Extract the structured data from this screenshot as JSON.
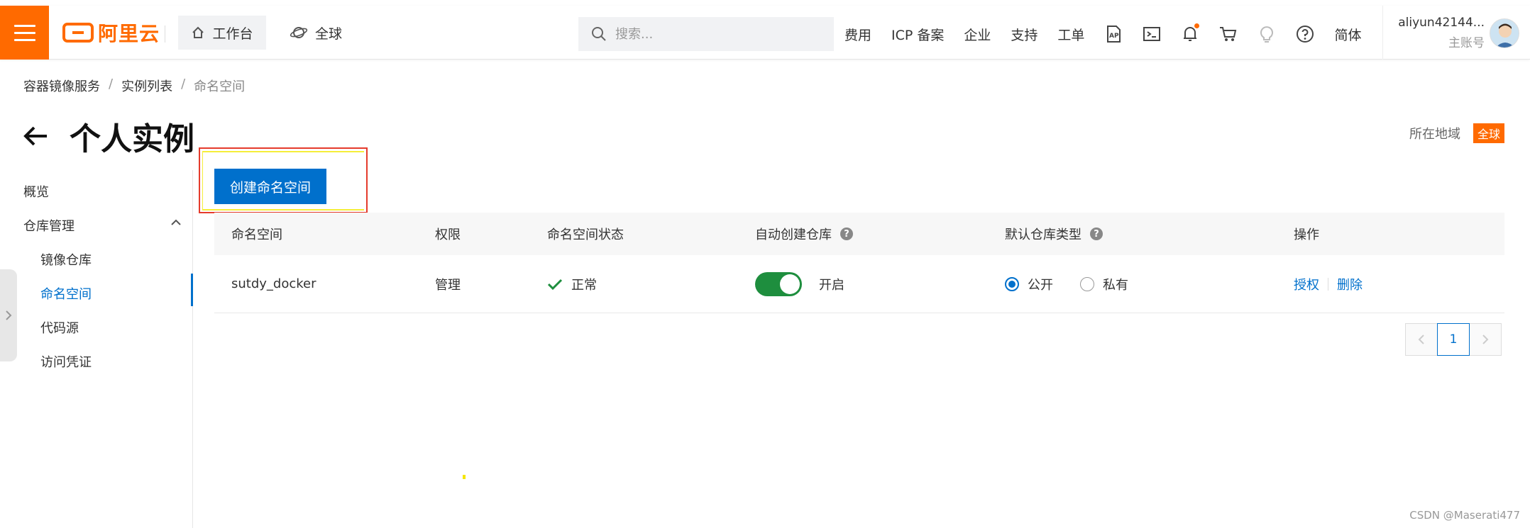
{
  "header": {
    "logo_text": "阿里云",
    "workbench": "工作台",
    "region_scope": "全球",
    "search_placeholder": "搜索...",
    "links": [
      "费用",
      "ICP 备案",
      "企业",
      "支持",
      "工单"
    ],
    "language": "简体",
    "account_name": "aliyun42144...",
    "account_type": "主账号"
  },
  "breadcrumb": {
    "items": [
      "容器镜像服务",
      "实例列表",
      "命名空间"
    ]
  },
  "page": {
    "title": "个人实例",
    "region_label": "所在地域",
    "region_value": "全球"
  },
  "sidebar": {
    "items": [
      {
        "label": "概览"
      },
      {
        "label": "仓库管理"
      },
      {
        "label": "镜像仓库"
      },
      {
        "label": "命名空间"
      },
      {
        "label": "代码源"
      },
      {
        "label": "访问凭证"
      }
    ],
    "active": "命名空间"
  },
  "toolbar": {
    "create_label": "创建命名空间"
  },
  "table": {
    "headers": [
      "命名空间",
      "权限",
      "命名空间状态",
      "自动创建仓库",
      "默认仓库类型",
      "操作"
    ],
    "rows": [
      {
        "namespace": "sutdy_docker",
        "permission": "管理",
        "status": "正常",
        "auto_create": "开启",
        "auto_create_on": true,
        "repo_type_public": "公开",
        "repo_type_private": "私有",
        "selected_type": "公开",
        "op_authorize": "授权",
        "op_delete": "删除"
      }
    ]
  },
  "pagination": {
    "current_page": "1"
  },
  "watermark": "CSDN @Maserati477",
  "colors": {
    "brand": "#ff6a00",
    "primary": "#0070cc",
    "success": "#1e8e3e"
  }
}
